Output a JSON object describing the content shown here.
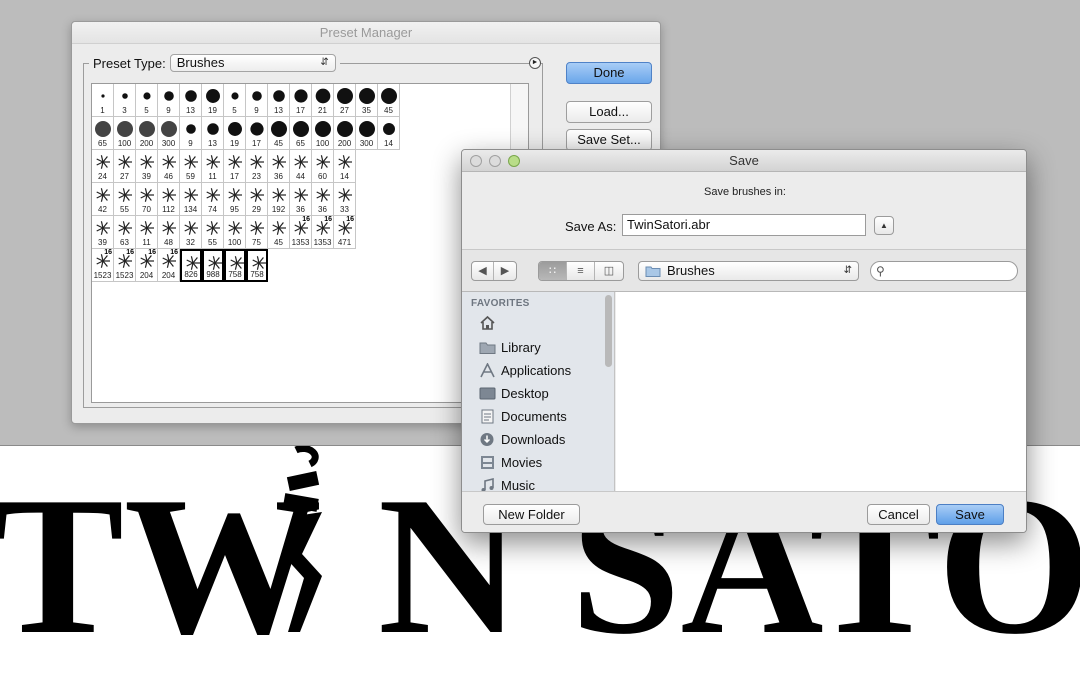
{
  "preset_manager": {
    "title": "Preset Manager",
    "type_label": "Preset Type:",
    "type_value": "Brushes",
    "buttons": {
      "done": "Done",
      "load": "Load...",
      "save_set": "Save Set..."
    },
    "brushes": [
      [
        "1",
        "3",
        "5",
        "9",
        "13",
        "19",
        "5",
        "9",
        "13",
        "17",
        "21",
        "27",
        "35",
        "45"
      ],
      [
        "65",
        "100",
        "200",
        "300",
        "9",
        "13",
        "19",
        "17",
        "45",
        "65",
        "100",
        "200",
        "300",
        "14"
      ],
      [
        "24",
        "27",
        "39",
        "46",
        "59",
        "11",
        "17",
        "23",
        "36",
        "44",
        "60",
        "14"
      ],
      [
        "42",
        "55",
        "70",
        "112",
        "134",
        "74",
        "95",
        "29",
        "192",
        "36",
        "36",
        "33"
      ],
      [
        "39",
        "63",
        "11",
        "48",
        "32",
        "55",
        "100",
        "75",
        "45",
        "1353",
        "1353",
        "471"
      ],
      [
        "1523",
        "1523",
        "204",
        "204",
        "826",
        "988",
        "758",
        "758"
      ]
    ],
    "badge": "16"
  },
  "save_dialog": {
    "title": "Save",
    "save_in_label": "Save brushes in:",
    "save_as_label": "Save As:",
    "save_as_value": "TwinSatori.abr",
    "folder": "Brushes",
    "sidebar_heading": "FAVORITES",
    "sidebar_items": [
      "Library",
      "Applications",
      "Desktop",
      "Documents",
      "Downloads",
      "Movies",
      "Music"
    ],
    "buttons": {
      "new_folder": "New Folder",
      "cancel": "Cancel",
      "save": "Save"
    }
  },
  "banner": {
    "word1": "TW",
    "word2": "N SATO"
  },
  "colors": {
    "accent": "#6aa6ea",
    "canvas": "#bcbcbc"
  }
}
